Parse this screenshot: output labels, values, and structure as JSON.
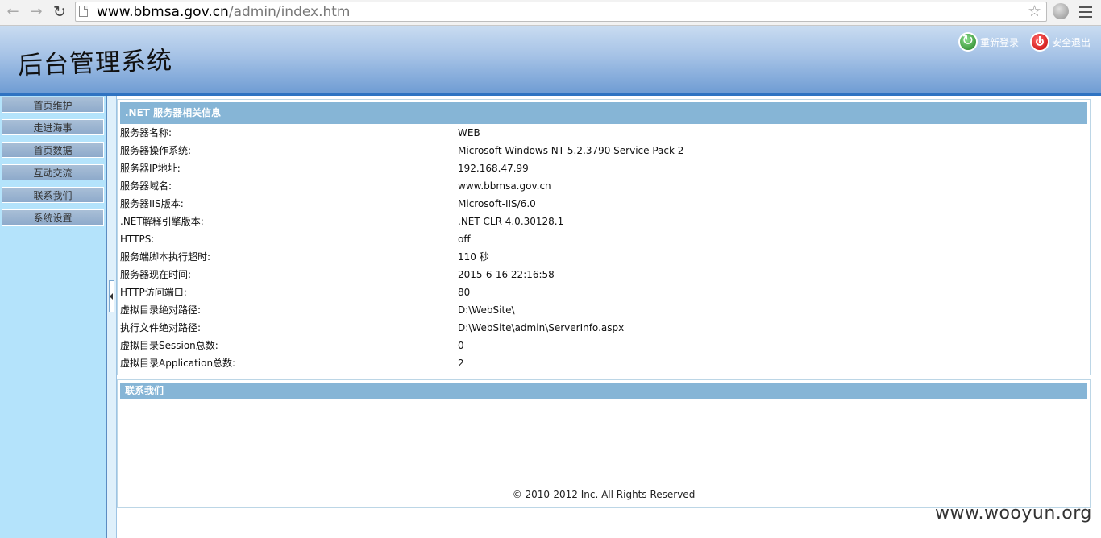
{
  "browser": {
    "url_host": "www.bbmsa.gov.cn",
    "url_path": "/admin/index.htm",
    "icons": [
      "back-arrow-icon",
      "forward-arrow-icon",
      "reload-icon",
      "page-icon",
      "bookmark-star-icon",
      "globe-extension-icon",
      "hamburger-menu-icon"
    ]
  },
  "header": {
    "title": "后台管理系统",
    "relogin_label": "重新登录",
    "logout_label": "安全退出"
  },
  "sidebar": {
    "items": [
      {
        "label": "首页维护"
      },
      {
        "label": "走进海事"
      },
      {
        "label": "首页数据"
      },
      {
        "label": "互动交流"
      },
      {
        "label": "联系我们"
      },
      {
        "label": "系统设置"
      }
    ]
  },
  "server_info": {
    "heading": ".NET 服务器相关信息",
    "rows": [
      {
        "label": "服务器名称:",
        "value": "WEB"
      },
      {
        "label": "服务器操作系统:",
        "value": "Microsoft Windows NT 5.2.3790 Service Pack 2"
      },
      {
        "label": "服务器IP地址:",
        "value": "192.168.47.99"
      },
      {
        "label": "服务器域名:",
        "value": "www.bbmsa.gov.cn"
      },
      {
        "label": "服务器IIS版本:",
        "value": "Microsoft-IIS/6.0"
      },
      {
        "label": ".NET解释引擎版本:",
        "value": ".NET CLR 4.0.30128.1"
      },
      {
        "label": "HTTPS:",
        "value": "off"
      },
      {
        "label": "服务端脚本执行超时:",
        "value": "110 秒"
      },
      {
        "label": "服务器现在时间:",
        "value": "2015-6-16 22:16:58"
      },
      {
        "label": "HTTP访问端口:",
        "value": "80"
      },
      {
        "label": "虚拟目录绝对路径:",
        "value": "D:\\WebSite\\"
      },
      {
        "label": "执行文件绝对路径:",
        "value": "D:\\WebSite\\admin\\ServerInfo.aspx"
      },
      {
        "label": "虚拟目录Session总数:",
        "value": "0"
      },
      {
        "label": "虚拟目录Application总数:",
        "value": "2"
      }
    ]
  },
  "contact": {
    "heading": "联系我们",
    "footer": "© 2010-2012 Inc. All Rights Reserved"
  },
  "watermark": "www.wooyun.org"
}
